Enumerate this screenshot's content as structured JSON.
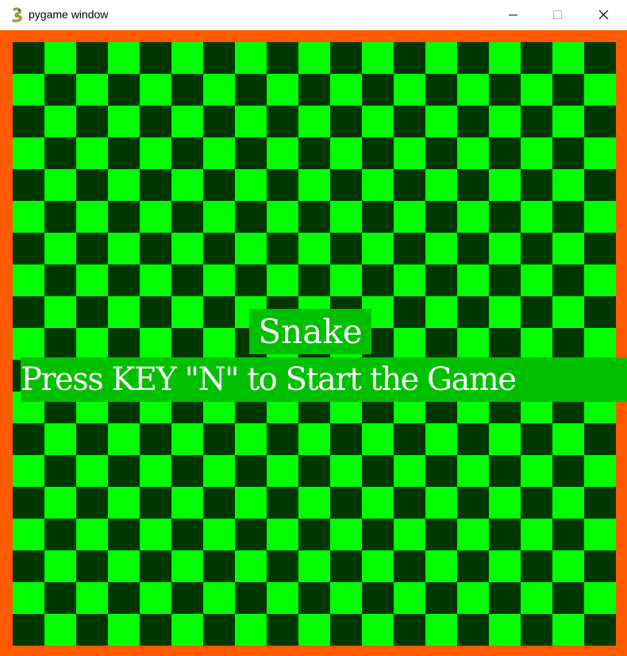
{
  "window": {
    "title": "pygame window",
    "app_icon": "python-snake-icon",
    "controls": {
      "minimize_icon": "minimize-icon",
      "maximize_icon": "maximize-icon",
      "close_icon": "close-icon"
    }
  },
  "game": {
    "title": "Snake",
    "prompt": "Press KEY \"N\" to Start the Game",
    "colors": {
      "border": "#ff5a00",
      "tile_light": "#00ff00",
      "tile_dark": "#003800",
      "text_background": "#00c000",
      "text": "#ffffff"
    }
  }
}
